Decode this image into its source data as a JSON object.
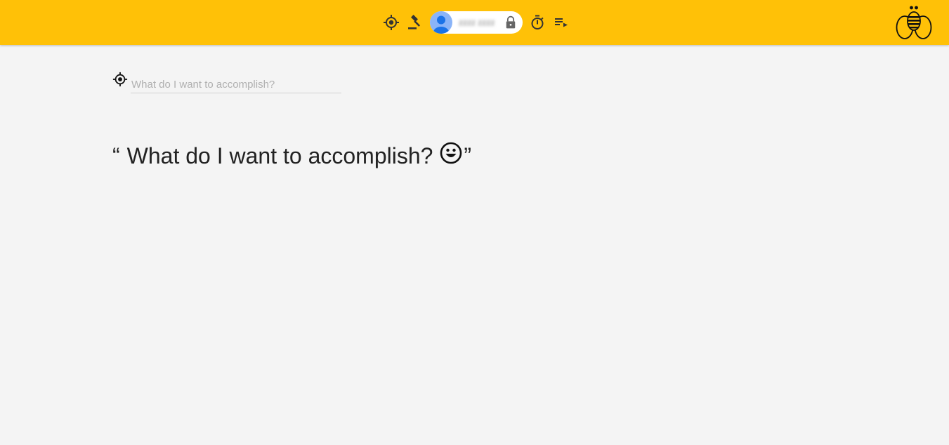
{
  "header": {
    "brand_color": "#ffc107",
    "toolbar": [
      {
        "icon": "target-icon",
        "label": "Goal"
      },
      {
        "icon": "gavel-icon",
        "label": "Decide"
      },
      {
        "icon": "stopwatch-icon",
        "label": "Timer"
      },
      {
        "icon": "playlist-icon",
        "label": "List"
      }
    ],
    "user": {
      "display_name": "zzzz zzzz",
      "avatar_color": "#8ab4f8",
      "lock_icon": "lock-icon"
    },
    "logo_icon": "bee-logo-icon"
  },
  "main": {
    "goal_input": {
      "placeholder": "What do I want to accomplish?",
      "value": ""
    },
    "quote": {
      "open_mark": "“",
      "text": "What do I want to accomplish?",
      "close_mark": "”",
      "emoji_icon": "smiley-icon"
    }
  }
}
